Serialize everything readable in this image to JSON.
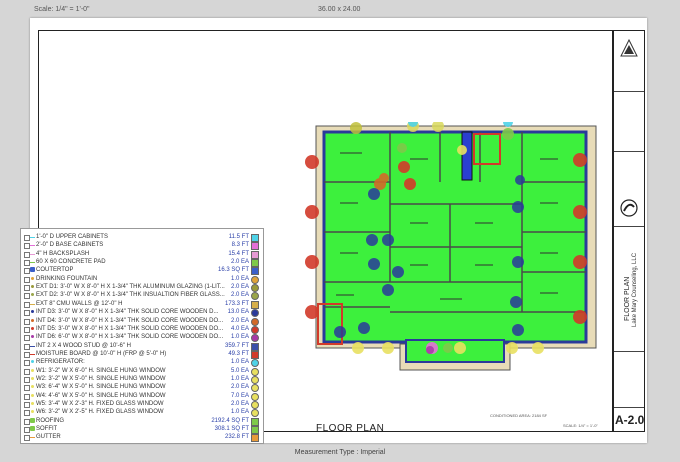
{
  "header": {
    "scale": "Scale: 1/4\" = 1'-0\"",
    "dimensions": "36.00 x 24.00"
  },
  "sheet": {
    "title": "FLOOR PLAN",
    "number": "A-2.0",
    "tb_title": "FLOOR PLAN",
    "company": "Lake Mary Counseling, LLC",
    "area_note": "CONDITIONED AREA: 2184 SF",
    "scale_note": "SCALE: 1/4\" = 1'-0\""
  },
  "legend": {
    "items": [
      {
        "label": "1'-0\" D UPPER CABINETS",
        "qty": "11.5 FT",
        "mark": "line",
        "color": "#4fd3e8"
      },
      {
        "label": "2'-0\" D BASE CABINETS",
        "qty": "8.3 FT",
        "mark": "line",
        "color": "#e46fd8"
      },
      {
        "label": "4\" H BACKSPLASH",
        "qty": "15.4 FT",
        "mark": "line",
        "color": "#e89ad6"
      },
      {
        "label": "60 X 60 CONCRETE PAD",
        "qty": "2.0 EA",
        "mark": "line",
        "color": "#7fc94a"
      },
      {
        "label": "COUTERTOP",
        "qty": "16.3 SQ FT",
        "mark": "area",
        "color": "#3b5fc9"
      },
      {
        "label": "DRINKING FOUNTAIN",
        "qty": "1.0 EA",
        "mark": "dot",
        "color": "#e0a33a"
      },
      {
        "label": "EXT D1: 3'-0\" W X 8'-0\" H X 1-3/4\" THK ALUMINUM GLAZING (1-LIT...",
        "qty": "2.0 EA",
        "mark": "dot",
        "color": "#9a9a3a"
      },
      {
        "label": "EXT D2: 3'-0\" W X 8'-0\" H X 1-3/4\" THK INSUALTION FIBER GLASS...",
        "qty": "2.0 EA",
        "mark": "dot",
        "color": "#9aa54a"
      },
      {
        "label": "EXT 8\" CMU WALLS @ 12'-0\" H",
        "qty": "173.3 FT",
        "mark": "line",
        "color": "#d8b04a"
      },
      {
        "label": "INT D3: 3'-0\" W X 8'-0\" H X 1-3/4\" THK SOLID CORE WOODEN D...",
        "qty": "13.0 EA",
        "mark": "dot",
        "color": "#2a3a9a"
      },
      {
        "label": "INT D4: 3'-0\" W X 8'-0\" H X 1-3/4\" THK SOLID CORE WOODEN DO...",
        "qty": "2.0 EA",
        "mark": "dot",
        "color": "#d26a28"
      },
      {
        "label": "INT D5: 3'-0\" W X 8'-0\" H X 1-3/4\" THK SOLID CORE WOODEN DO...",
        "qty": "4.0 EA",
        "mark": "dot",
        "color": "#d23a2a"
      },
      {
        "label": "INT D6: 6'-0\" W X 8'-0\" H X 1-3/4\" THK SOLID CORE WOODEN DO...",
        "qty": "1.0 EA",
        "mark": "dot",
        "color": "#a83aa8"
      },
      {
        "label": "INT 2 X 4 WOOD STUD @ 10'-6\" H",
        "qty": "359.7 FT",
        "mark": "line",
        "color": "#3a4fa8"
      },
      {
        "label": "MOISTURE BOARD @ 10'-0\" H (FRP @ 5'-0\" H)",
        "qty": "49.3 FT",
        "mark": "line",
        "color": "#d23a2a"
      },
      {
        "label": "REFRIGERATOR:",
        "qty": "1.0 EA",
        "mark": "dot",
        "color": "#4fd3e8"
      },
      {
        "label": "W1: 3'-2\" W X 6'-0\" H. SINGLE HUNG WINDOW",
        "qty": "5.0 EA",
        "mark": "dot",
        "color": "#e8e060"
      },
      {
        "label": "W2: 3'-2\" W X 5'-0\" H. SINGLE HUNG WINDOW",
        "qty": "1.0 EA",
        "mark": "dot",
        "color": "#e8e060"
      },
      {
        "label": "W3: 6'-4\" W X 5'-0\" H. SINGLE HUNG WINDOW",
        "qty": "2.0 EA",
        "mark": "dot",
        "color": "#e8e060"
      },
      {
        "label": "W4: 4'-6\" W X 5'-0\" H. SINGLE HUNG WINDOW",
        "qty": "7.0 EA",
        "mark": "dot",
        "color": "#e8e060"
      },
      {
        "label": "W5: 3'-4\" W X 2'-3\" H. FIXED GLASS WINDOW",
        "qty": "2.0 EA",
        "mark": "dot",
        "color": "#e8e060"
      },
      {
        "label": "W6: 3'-2\" W X 2'-5\" H. FIXED GLASS WINDOW",
        "qty": "1.0 EA",
        "mark": "dot",
        "color": "#e8e060"
      },
      {
        "label": "ROOFING",
        "qty": "2192.4 SQ FT",
        "mark": "area",
        "color": "#7fc94a"
      },
      {
        "label": "SOFFIT",
        "qty": "308.1 SQ FT",
        "mark": "area",
        "color": "#7fc94a"
      },
      {
        "label": "GUTTER",
        "qty": "232.8 FT",
        "mark": "line",
        "color": "#e89a3a"
      }
    ]
  },
  "plan": {
    "room_color": "#3df03d",
    "wall_color": "#2a3a9a"
  },
  "status": "Measurement Type : Imperial"
}
